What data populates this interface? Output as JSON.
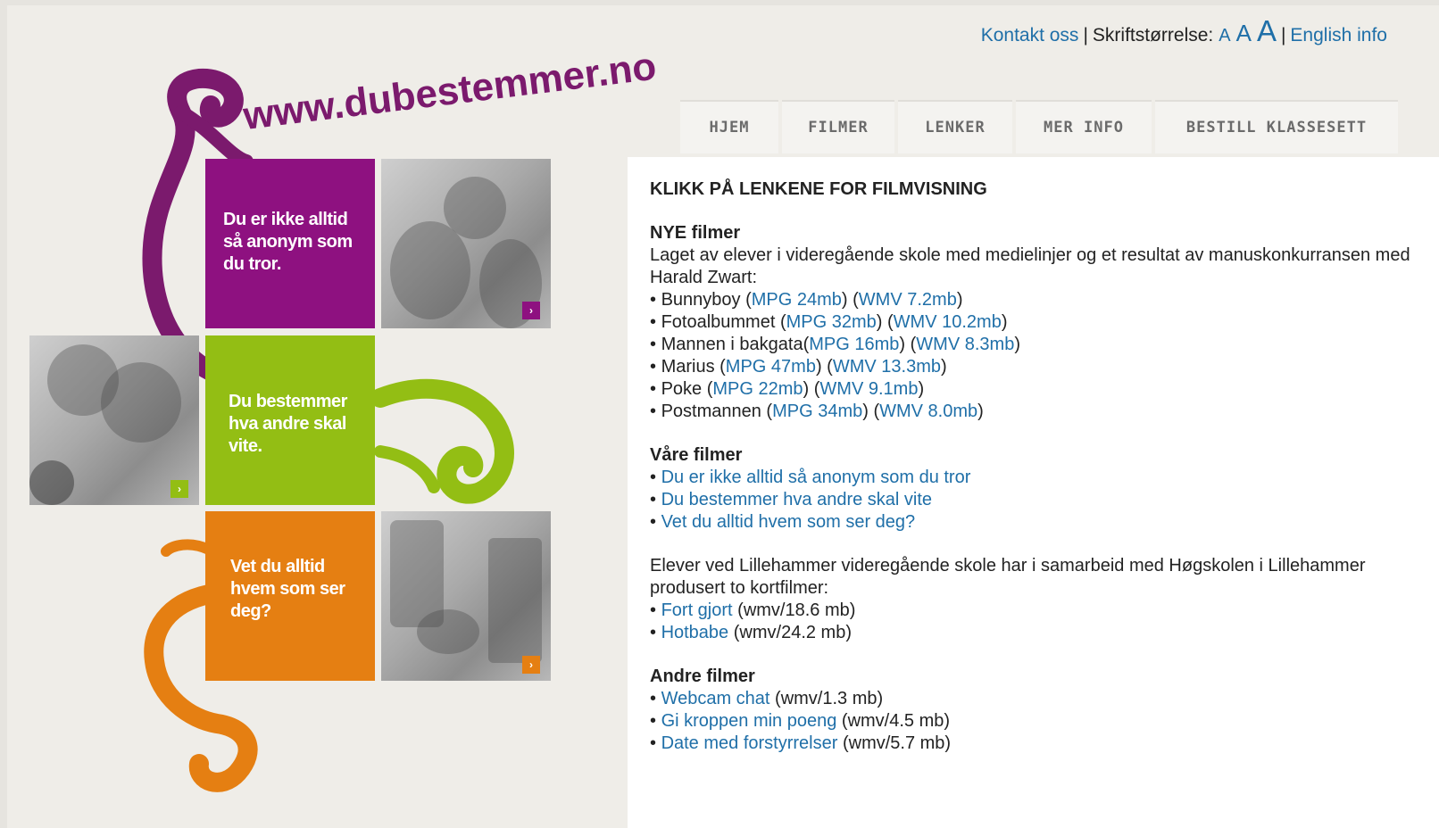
{
  "util": {
    "contact": "Kontakt oss",
    "sep": "|",
    "font_size_label": "Skriftstørrelse:",
    "font_size_small": "A",
    "font_size_medium": "A",
    "font_size_large": "A",
    "english": "English info"
  },
  "logo": {
    "text": "www.dubestemmer.no"
  },
  "nav": {
    "items": [
      {
        "label": "HJEM"
      },
      {
        "label": "FILMER"
      },
      {
        "label": "LENKER"
      },
      {
        "label": "MER INFO"
      },
      {
        "label": "BESTILL KLASSESETT"
      }
    ]
  },
  "tiles": {
    "purple": {
      "line1": "Du er ikke alltid",
      "line2": "så anonym som",
      "line3": "du tror."
    },
    "green": {
      "line1": "Du bestemmer",
      "line2": "hva andre skal",
      "line3": "vite."
    },
    "orange": {
      "line1": "Vet du alltid",
      "line2": "hvem som ser",
      "line3": "deg?"
    },
    "play_glyph": "›"
  },
  "colors": {
    "purple": "#8e1180",
    "green": "#93be14",
    "orange": "#e57f12",
    "link": "#1f6fa8",
    "logo": "#7b1a6d"
  },
  "content": {
    "heading": "KLIKK PÅ LENKENE FOR FILMVISNING",
    "new": {
      "title": "NYE filmer",
      "intro": "Laget av elever i videregående skole med medielinjer og et resultat av manuskonkurransen med Harald Zwart:",
      "films": [
        {
          "name": "Bunnyboy",
          "mpg": "MPG 24mb",
          "wmv": "WMV 7.2mb",
          "sp": " "
        },
        {
          "name": "Fotoalbummet",
          "mpg": "MPG 32mb",
          "wmv": "WMV 10.2mb",
          "sp": " "
        },
        {
          "name": "Mannen i bakgata",
          "mpg": "MPG 16mb",
          "wmv": "WMV 8.3mb",
          "sp": ""
        },
        {
          "name": "Marius",
          "mpg": "MPG 47mb",
          "wmv": "WMV 13.3mb",
          "sp": " "
        },
        {
          "name": "Poke",
          "mpg": "MPG 22mb",
          "wmv": "WMV 9.1mb",
          "sp": " "
        },
        {
          "name": "Postmannen",
          "mpg": "MPG 34mb",
          "wmv": "WMV 8.0mb",
          "sp": " "
        }
      ]
    },
    "ours": {
      "title": "Våre filmer",
      "links": [
        "Du er ikke alltid så anonym som du tror",
        "Du bestemmer hva andre skal vite",
        "Vet du alltid hvem som ser deg?"
      ]
    },
    "lillehammer": {
      "intro": "Elever ved Lillehammer videregående skole har i samarbeid med Høgskolen i Lillehammer produsert to kortfilmer:",
      "films": [
        {
          "name": "Fort gjort",
          "info": "(wmv/18.6 mb)"
        },
        {
          "name": "Hotbabe",
          "info": "(wmv/24.2 mb)"
        }
      ]
    },
    "other": {
      "title": "Andre filmer",
      "films": [
        {
          "name": "Webcam chat",
          "info": "(wmv/1.3 mb)"
        },
        {
          "name": "Gi kroppen min poeng",
          "info": "(wmv/4.5 mb)"
        },
        {
          "name": "Date med forstyrrelser",
          "info": "(wmv/5.7 mb)"
        }
      ]
    }
  }
}
